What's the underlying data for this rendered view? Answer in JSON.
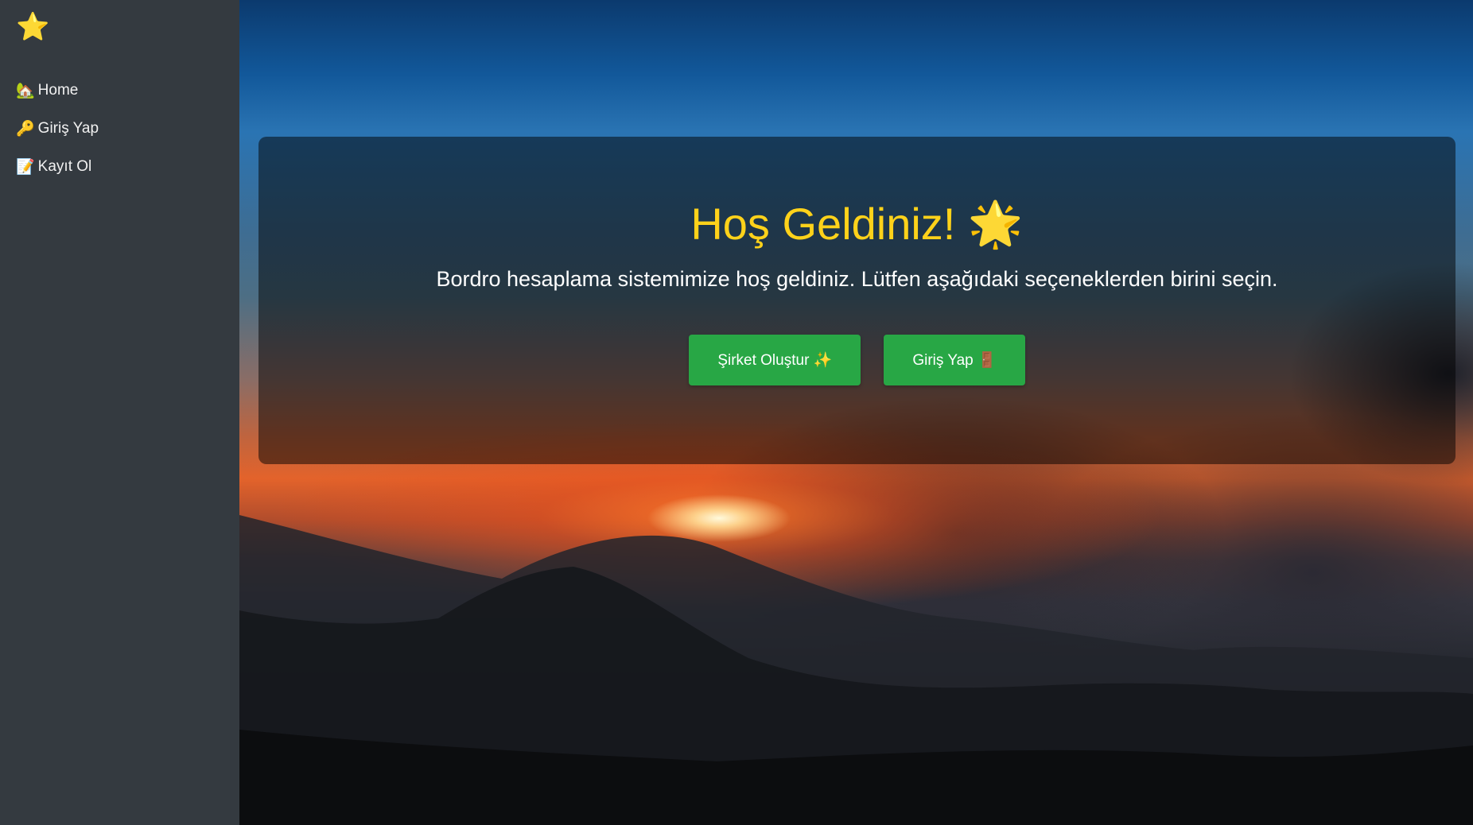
{
  "sidebar": {
    "brand_icon": "⭐",
    "items": [
      {
        "icon": "🏡",
        "label": "Home"
      },
      {
        "icon": "🔑",
        "label": "Giriş Yap"
      },
      {
        "icon": "📝",
        "label": "Kayıt Ol"
      }
    ]
  },
  "welcome": {
    "title": "Hoş Geldiniz! 🌟",
    "subtitle": "Bordro hesaplama sistemimize hoş geldiniz. Lütfen aşağıdaki seçeneklerden birini seçin.",
    "create_company_label": "Şirket Oluştur ✨",
    "login_label": "Giriş Yap 🚪"
  },
  "colors": {
    "sidebar_bg": "#343a40",
    "title_color": "#ffd21a",
    "button_bg": "#28a745"
  }
}
